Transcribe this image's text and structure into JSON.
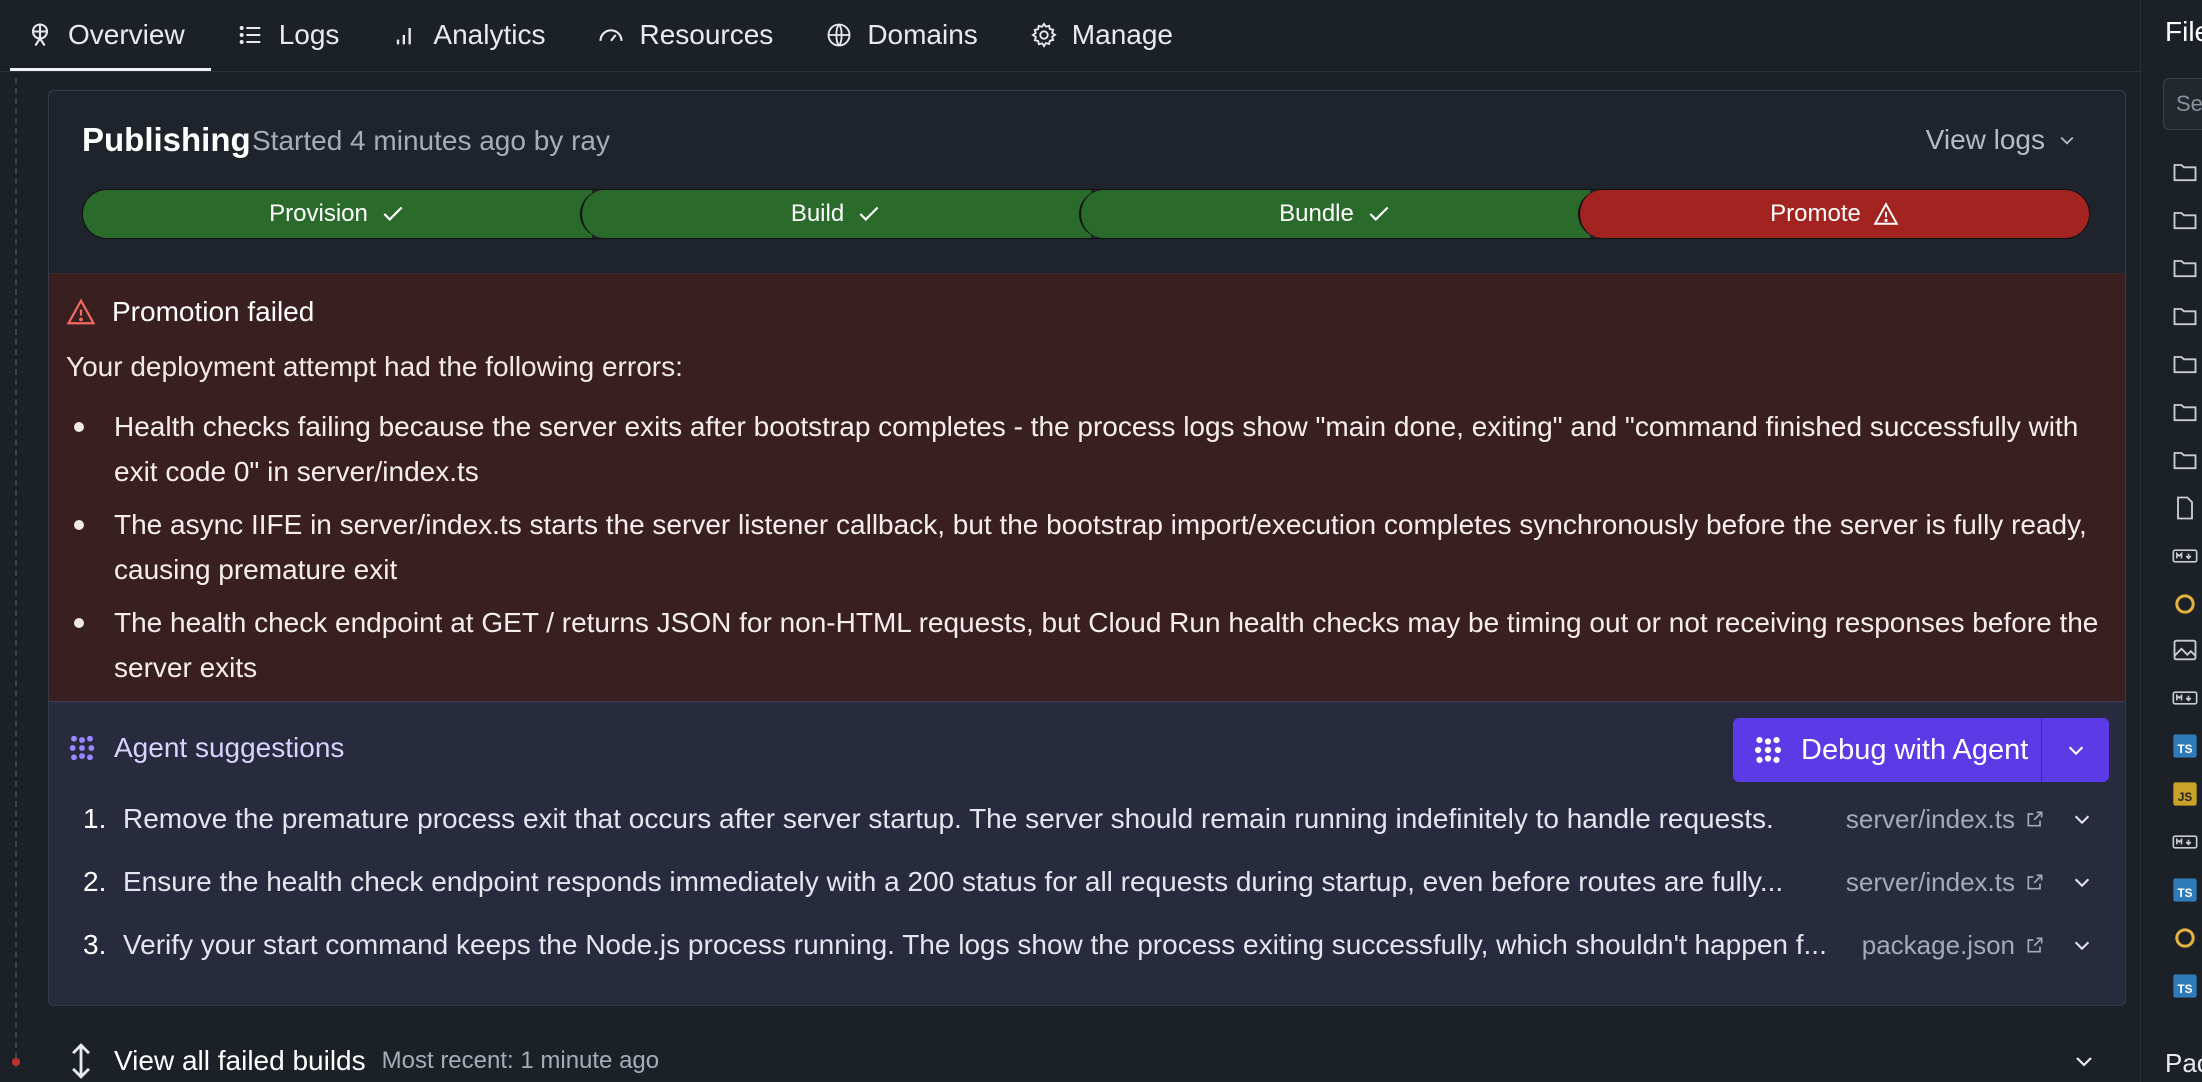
{
  "nav": {
    "tabs": [
      {
        "label": "Overview",
        "icon": "overview-icon"
      },
      {
        "label": "Logs",
        "icon": "list-icon"
      },
      {
        "label": "Analytics",
        "icon": "bar-chart-icon"
      },
      {
        "label": "Resources",
        "icon": "gauge-icon"
      },
      {
        "label": "Domains",
        "icon": "globe-icon"
      },
      {
        "label": "Manage",
        "icon": "gear-icon"
      }
    ],
    "active_tab": "Overview"
  },
  "publishing": {
    "title": "Publishing",
    "subtitle": "Started 4 minutes ago by ray",
    "view_logs": "View logs",
    "steps": [
      {
        "label": "Provision",
        "status": "success"
      },
      {
        "label": "Build",
        "status": "success"
      },
      {
        "label": "Bundle",
        "status": "success"
      },
      {
        "label": "Promote",
        "status": "error"
      }
    ]
  },
  "error": {
    "title": "Promotion failed",
    "intro": "Your deployment attempt had the following errors:",
    "items": [
      "Health checks failing because the server exits after bootstrap completes - the process logs show \"main done, exiting\" and \"command finished successfully with exit code 0\" in server/index.ts",
      "The async IIFE in server/index.ts starts the server listener callback, but the bootstrap import/execution completes synchronously before the server is fully ready, causing premature exit",
      "The health check endpoint at GET / returns JSON for non-HTML requests, but Cloud Run health checks may be timing out or not receiving responses before the server exits"
    ]
  },
  "agent": {
    "title": "Agent suggestions",
    "debug_button": "Debug with Agent",
    "suggestions": [
      {
        "num": "1.",
        "text": "Remove the premature process exit that occurs after server startup. The server should remain running indefinitely to handle requests.",
        "file": "server/index.ts"
      },
      {
        "num": "2.",
        "text": "Ensure the health check endpoint responds immediately with a 200 status for all requests during startup, even before routes are fully...",
        "file": "server/index.ts"
      },
      {
        "num": "3.",
        "text": "Verify your start command keeps the Node.js process running. The logs show the process exiting successfully, which shouldn't happen f...",
        "file": "package.json"
      }
    ]
  },
  "failed_builds": {
    "label": "View all failed builds",
    "sub": "Most recent: 1 minute ago"
  },
  "right_sidebar": {
    "title": "File",
    "search_placeholder": "Se",
    "bottom_label": "Pac"
  },
  "colors": {
    "success": "#2a6a2b",
    "error": "#a2231f",
    "agent_accent": "#5b3be6",
    "error_panel": "#3a1f21",
    "agent_panel": "#282a3e"
  }
}
